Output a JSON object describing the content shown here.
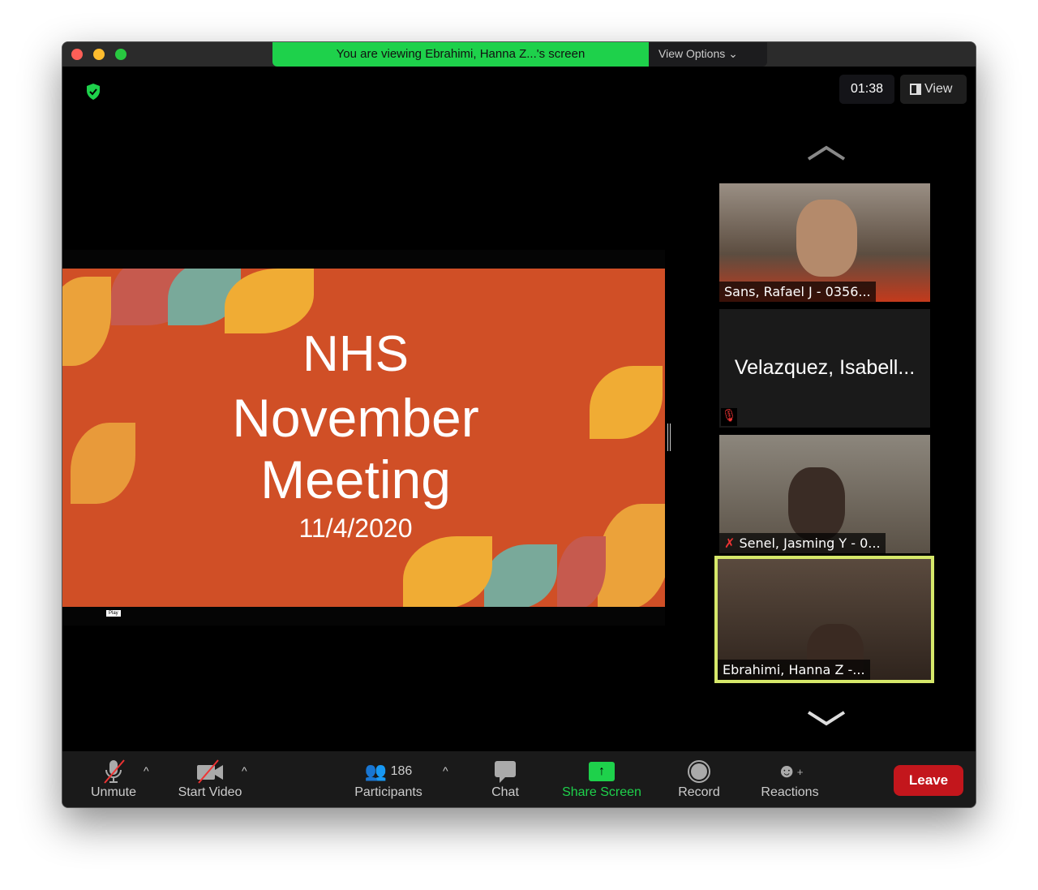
{
  "banner": "You are viewing Ebrahimi, Hanna Z...'s screen",
  "view_options": "View Options",
  "timer": "01:38",
  "view_label": "View",
  "slide": {
    "title1": "NHS",
    "title2": "November",
    "title3": "Meeting",
    "date": "11/4/2020",
    "play_tooltip": "Play"
  },
  "participants_tiles": [
    {
      "name": "Sans, Rafael J - 0356..."
    },
    {
      "name": "Velazquez, Isabell..."
    },
    {
      "name": "Senel, Jasming Y - 0..."
    },
    {
      "name": "Ebrahimi, Hanna Z -..."
    }
  ],
  "toolbar": {
    "unmute": "Unmute",
    "start_video": "Start Video",
    "participants_count": "186",
    "participants": "Participants",
    "chat": "Chat",
    "share_screen": "Share Screen",
    "record": "Record",
    "reactions": "Reactions",
    "leave": "Leave"
  },
  "colors": {
    "green": "#1ed14b",
    "leave": "#c3161c",
    "slide_bg": "#d04f26",
    "active_border": "#d6e86a"
  }
}
